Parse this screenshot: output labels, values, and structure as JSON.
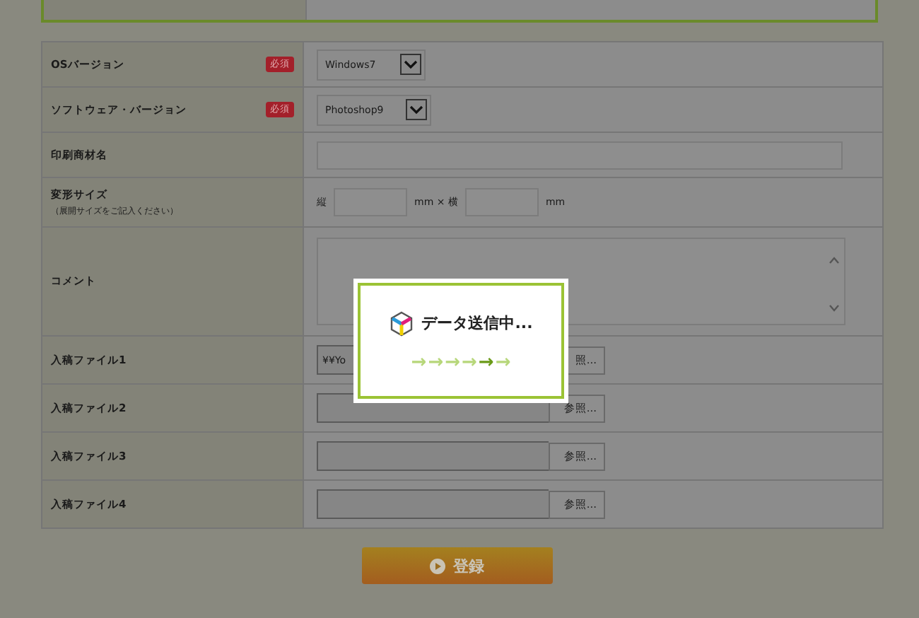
{
  "form": {
    "rows": [
      {
        "kind": "select",
        "label": "OSバージョン",
        "required": true,
        "badge": "必須",
        "value": "Windows7"
      },
      {
        "kind": "select",
        "label": "ソフトウェア・バージョン",
        "required": true,
        "badge": "必須",
        "value": "Photoshop9"
      },
      {
        "kind": "text",
        "label": "印刷商材名",
        "required": false
      },
      {
        "kind": "size",
        "label": "変形サイズ",
        "note": "（展開サイズをご記入ください）",
        "required": false,
        "prefix": "縦",
        "mid": "mm × 横",
        "suffix": "mm"
      },
      {
        "kind": "textarea",
        "label": "コメント",
        "required": false
      },
      {
        "kind": "file",
        "label": "入稿ファイル1",
        "required": false,
        "value": "¥¥Yo",
        "button": "照..."
      },
      {
        "kind": "file",
        "label": "入稿ファイル2",
        "required": false,
        "button": "参照..."
      },
      {
        "kind": "file",
        "label": "入稿ファイル3",
        "required": false,
        "button": "参照..."
      },
      {
        "kind": "file",
        "label": "入稿ファイル4",
        "required": false,
        "button": "参照..."
      }
    ]
  },
  "submit": {
    "label": "登録"
  },
  "modal": {
    "title": "データ送信中...",
    "arrows": [
      {
        "text": "→",
        "on": false
      },
      {
        "text": "→",
        "on": false
      },
      {
        "text": "→",
        "on": false
      },
      {
        "text": "→",
        "on": false
      },
      {
        "text": "→",
        "on": true
      },
      {
        "text": "→",
        "on": false
      }
    ]
  }
}
